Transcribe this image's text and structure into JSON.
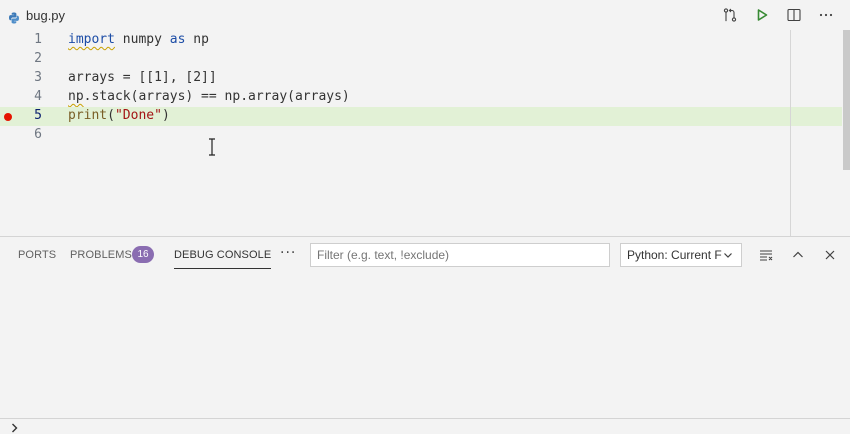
{
  "tab": {
    "file_name": "bug.py",
    "icon": "python-icon"
  },
  "tab_actions": {
    "icons": [
      "open-changes-icon",
      "run-python-file-icon",
      "split-editor-icon",
      "more-actions-icon"
    ]
  },
  "editor": {
    "lines": [
      {
        "number": "1"
      },
      {
        "number": "2"
      },
      {
        "number": "3"
      },
      {
        "number": "4"
      },
      {
        "number": "5"
      },
      {
        "number": "6"
      }
    ],
    "line1": {
      "kw_import": "import",
      "mod": " numpy ",
      "kw_as": "as",
      "alias": " np"
    },
    "line3": {
      "text": "arrays = [[1], [2]]"
    },
    "line4": {
      "np": "np",
      "rest": ".stack(arrays) == np.array(arrays)"
    },
    "line5": {
      "fn": "print",
      "open": "(",
      "str": "\"Done\"",
      "close": ")"
    },
    "breakpoint_line": 5,
    "current_line": 5
  },
  "panel": {
    "tabs": {
      "ports": "PORTS",
      "problems": "PROBLEMS",
      "debug_console": "DEBUG CONSOLE"
    },
    "problems_count": "16",
    "more": "···",
    "filter_placeholder": "Filter (e.g. text, !exclude)",
    "config_select": "Python: Current File",
    "actions": [
      "clear-console-icon",
      "maximize-panel-icon",
      "close-panel-icon"
    ]
  },
  "colors": {
    "current_line_bg": "#e2f1d6",
    "breakpoint": "#e51400",
    "badge": "#8a6db1",
    "run_green": "#388a34"
  }
}
